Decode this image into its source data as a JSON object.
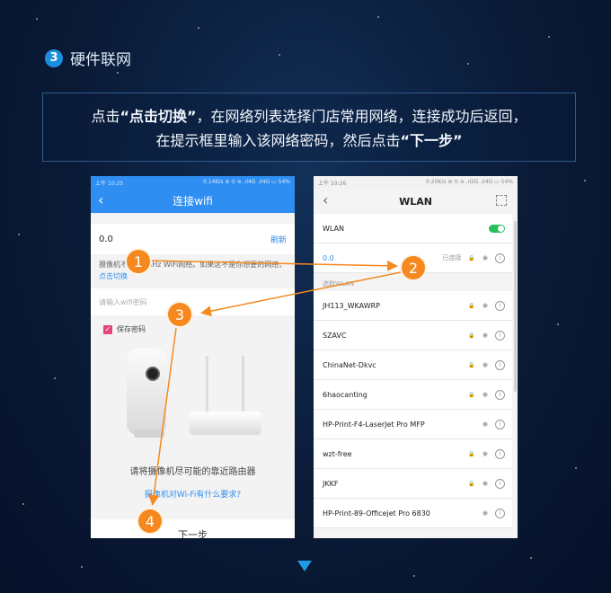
{
  "step": {
    "number": "3",
    "title": "硬件联网"
  },
  "instruction": {
    "line1_a": "点击",
    "line1_b": "“点击切换”",
    "line1_c": "，在网络列表选择门店常用网络，连接成功后返回，",
    "line2_a": "在提示框里输入该网络密码，然后点击",
    "line2_b": "“下一步”"
  },
  "left_phone": {
    "status_time": "上午 10:25",
    "status_right": "0.14K/s ⊚ ⏲ ≋ .ıl4G .ıl4G ▭ 54%",
    "title": "连接wifi",
    "wifi_value": "0.0",
    "refresh": "刷新",
    "note": "摄像机不支持5GHz WiFi网络。如果这不是你想要的网络，",
    "note_link": "点击切换",
    "password_placeholder": "请输入wifi密码",
    "save_password": "保存密码",
    "hint": "请将摄像机尽可能的靠近路由器",
    "requirement_link": "摄像机对Wi-Fi有什么要求?",
    "next_button": "下一步"
  },
  "right_phone": {
    "status_time": "上午 10:26",
    "status_right": "0.20K/s ⊚ ⏲ ≋ .ıl2G .ıl4G ▭ 54%",
    "title": "WLAN",
    "wlan_label": "WLAN",
    "wlan_on": true,
    "connected": {
      "name": "0.0",
      "status": "已连接"
    },
    "section_label": "选取WLAN",
    "networks": [
      {
        "name": "JH113_WKAWRP",
        "locked": true
      },
      {
        "name": "SZAVC",
        "locked": true
      },
      {
        "name": "ChinaNet-Dkvc",
        "locked": true
      },
      {
        "name": "6haocanting",
        "locked": true
      },
      {
        "name": "HP-Print-F4-LaserJet Pro MFP",
        "locked": false
      },
      {
        "name": "wzt-free",
        "locked": true
      },
      {
        "name": "JKKF",
        "locked": true
      },
      {
        "name": "HP-Print-89-Officejet Pro 6830",
        "locked": false
      }
    ]
  },
  "markers": [
    "1",
    "2",
    "3",
    "4"
  ],
  "colors": {
    "accent": "#1a8fe0",
    "marker": "#f5891f",
    "app_blue": "#2f8ef1",
    "toggle_on": "#2bc05c"
  }
}
